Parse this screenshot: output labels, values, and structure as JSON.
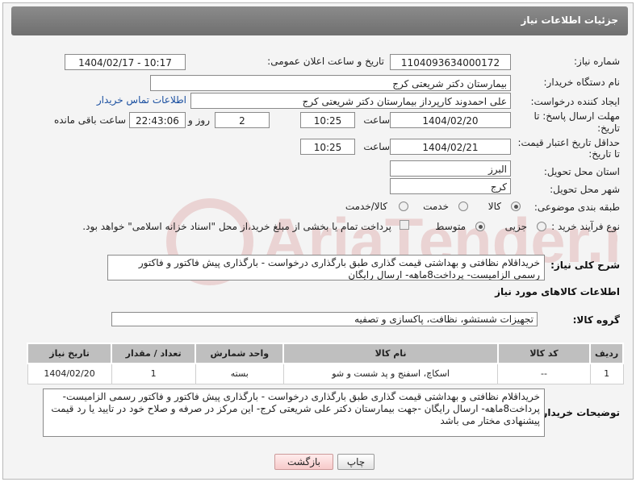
{
  "header": {
    "title": "جزئیات اطلاعات نیاز"
  },
  "form": {
    "need_number_label": "شماره نیاز:",
    "need_number": "1104093634000172",
    "announce_label": "تاریخ و ساعت اعلان عمومی:",
    "announce_value": "1404/02/17 - 10:17",
    "buyer_org_label": "نام دستگاه خریدار:",
    "buyer_org": "بیمارستان دکتر شریعتی کرج",
    "creator_label": "ایجاد کننده درخواست:",
    "creator": "علی احمدوند کارپرداز بیمارستان دکتر شریعتی کرج",
    "contact_link": "اطلاعات تماس خریدار",
    "reply_deadline_label_1": "مهلت ارسال پاسخ: تا",
    "reply_deadline_label_2": "تاریخ:",
    "reply_date": "1404/02/20",
    "time_label": "ساعت",
    "reply_time": "10:25",
    "days_value": "2",
    "days_label": "روز و",
    "remaining_time": "22:43:06",
    "remaining_label": "ساعت باقی مانده",
    "price_validity_label_1": "حداقل تاریخ اعتبار قیمت:",
    "price_validity_label_2": "تا تاریخ:",
    "price_date": "1404/02/21",
    "price_time": "10:25",
    "province_label": "استان محل تحویل:",
    "province": "البرز",
    "city_label": "شهر محل تحویل:",
    "city": "کرج",
    "category_label": "طبقه بندی موضوعی:",
    "category_options": [
      "کالا",
      "خدمت",
      "کالا/خدمت"
    ],
    "process_label": "نوع فرآیند خرید :",
    "process_options": [
      "جزیی",
      "متوسط"
    ],
    "payment_note": "پرداخت تمام یا بخشی از مبلغ خرید،از محل \"اسناد خزانه اسلامی\" خواهد بود.",
    "description_label": "شرح کلی نیاز:",
    "description": "خریداقلام نظافتی و بهداشتی  قیمت گذاری   طبق بارگذاری درخواست  - بارگذاری  پیش فاکتور و فاکتور رسمی الزامیست- پرداخت8ماهه- ارسال رایگان"
  },
  "goods": {
    "section_title": "اطلاعات کالاهای مورد نیاز",
    "group_label": "گروه کالا:",
    "group_value": "تجهیزات شستشو، نظافت، پاکسازی و تصفیه",
    "columns": [
      "ردیف",
      "کد کالا",
      "نام کالا",
      "واحد شمارش",
      "تعداد / مقدار",
      "تاریخ نیاز"
    ],
    "rows": [
      [
        "1",
        "--",
        "اسکاچ، اسفنج و پد شست و شو",
        "بسته",
        "1",
        "1404/02/20"
      ]
    ]
  },
  "buyer_notes": {
    "label": "توضیحات خریدار:",
    "text": "خریداقلام نظافتی و بهداشتی  قیمت گذاری   طبق بارگذاری درخواست  - بارگذاری  پیش فاکتور و فاکتور رسمی الزامیست- پرداخت8ماهه- ارسال رایگان -جهت بیمارستان دکتر علی شریعتی کرج- این مرکز در صرفه و صلاح خود در تایید یا رد قیمت پیشنهادی مختار می باشد"
  },
  "buttons": {
    "print": "چاپ",
    "back": "بازگشت"
  },
  "watermark": {
    "text": "AriaTender.neT"
  }
}
